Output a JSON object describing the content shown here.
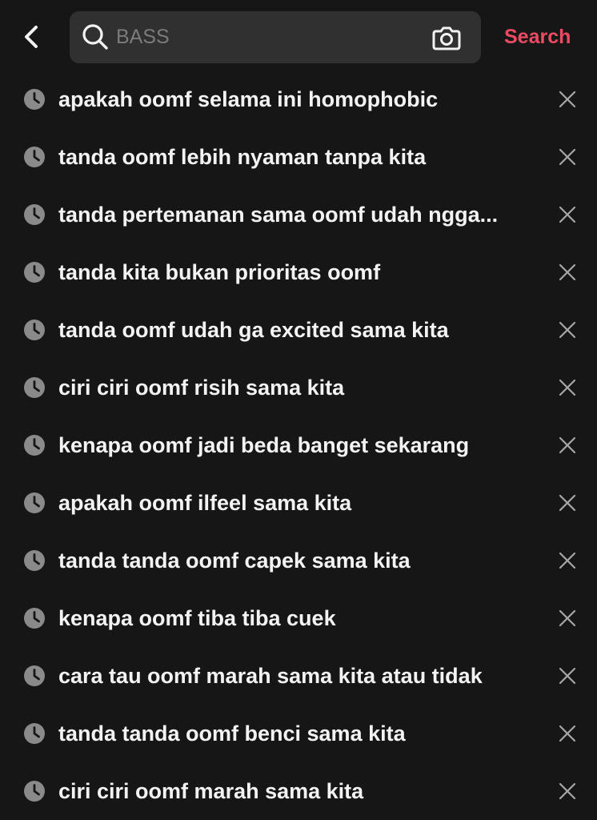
{
  "header": {
    "back_icon": "chevron-left-icon",
    "search": {
      "icon": "search-icon",
      "value": "",
      "placeholder": "BASS",
      "camera_icon": "camera-icon"
    },
    "search_button_label": "Search"
  },
  "history": {
    "item_icon": "clock-icon",
    "remove_icon": "close-icon",
    "items": [
      "apakah oomf selama ini homophobic",
      "tanda oomf lebih nyaman tanpa kita",
      "tanda pertemanan sama oomf udah ngga...",
      "tanda kita bukan prioritas oomf",
      "tanda oomf udah ga excited sama kita",
      "ciri ciri oomf risih sama kita",
      "kenapa oomf jadi beda banget sekarang",
      "apakah oomf ilfeel sama kita",
      "tanda tanda oomf capek sama kita",
      "kenapa oomf tiba tiba cuek",
      "cara tau oomf marah sama kita atau tidak",
      "tanda tanda oomf benci sama kita",
      "ciri ciri oomf marah sama kita"
    ]
  },
  "colors": {
    "background": "#161616",
    "search_field": "#303030",
    "accent": "#ec4b62",
    "text": "#f3f3f3",
    "muted_icon": "#8a8a8a"
  }
}
